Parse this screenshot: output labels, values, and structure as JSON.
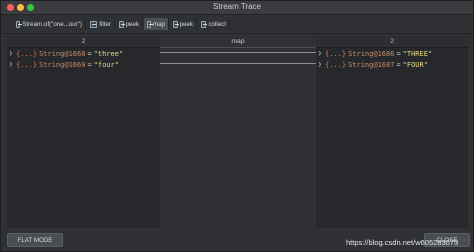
{
  "window": {
    "title": "Stream Trace"
  },
  "tabs": [
    {
      "label": "Stream.of(\"one...our\")",
      "icon": "stream-icon"
    },
    {
      "label": "filter",
      "icon": "stream-icon"
    },
    {
      "label": "peek",
      "icon": "stream-icon"
    },
    {
      "label": "map",
      "icon": "stream-icon",
      "selected": true
    },
    {
      "label": "peek",
      "icon": "stream-icon"
    },
    {
      "label": "collect",
      "icon": "stream-icon"
    }
  ],
  "left_panel": {
    "count": "2",
    "items": [
      {
        "brace": "{...}",
        "type": "String@1668",
        "eq": "=",
        "value": "\"three\""
      },
      {
        "brace": "{...}",
        "type": "String@1669",
        "eq": "=",
        "value": "\"four\""
      }
    ]
  },
  "middle": {
    "label": "map"
  },
  "right_panel": {
    "count": "2",
    "items": [
      {
        "brace": "{...}",
        "type": "String@1686",
        "eq": "=",
        "value": "\"THREE\""
      },
      {
        "brace": "{...}",
        "type": "String@1687",
        "eq": "=",
        "value": "\"FOUR\""
      }
    ]
  },
  "buttons": {
    "flat_mode": "FLAT MODE",
    "close": "CLOSE"
  },
  "watermark": "https://blog.csdn.net/w605283073",
  "colors": {
    "window_bg": "#2f3134",
    "panel_bg": "#26282b",
    "string_value": "#e8d789",
    "object_type": "#c98a6a",
    "traffic_close": "#fc605c",
    "traffic_min": "#fdbc40",
    "traffic_max": "#34c84a"
  }
}
